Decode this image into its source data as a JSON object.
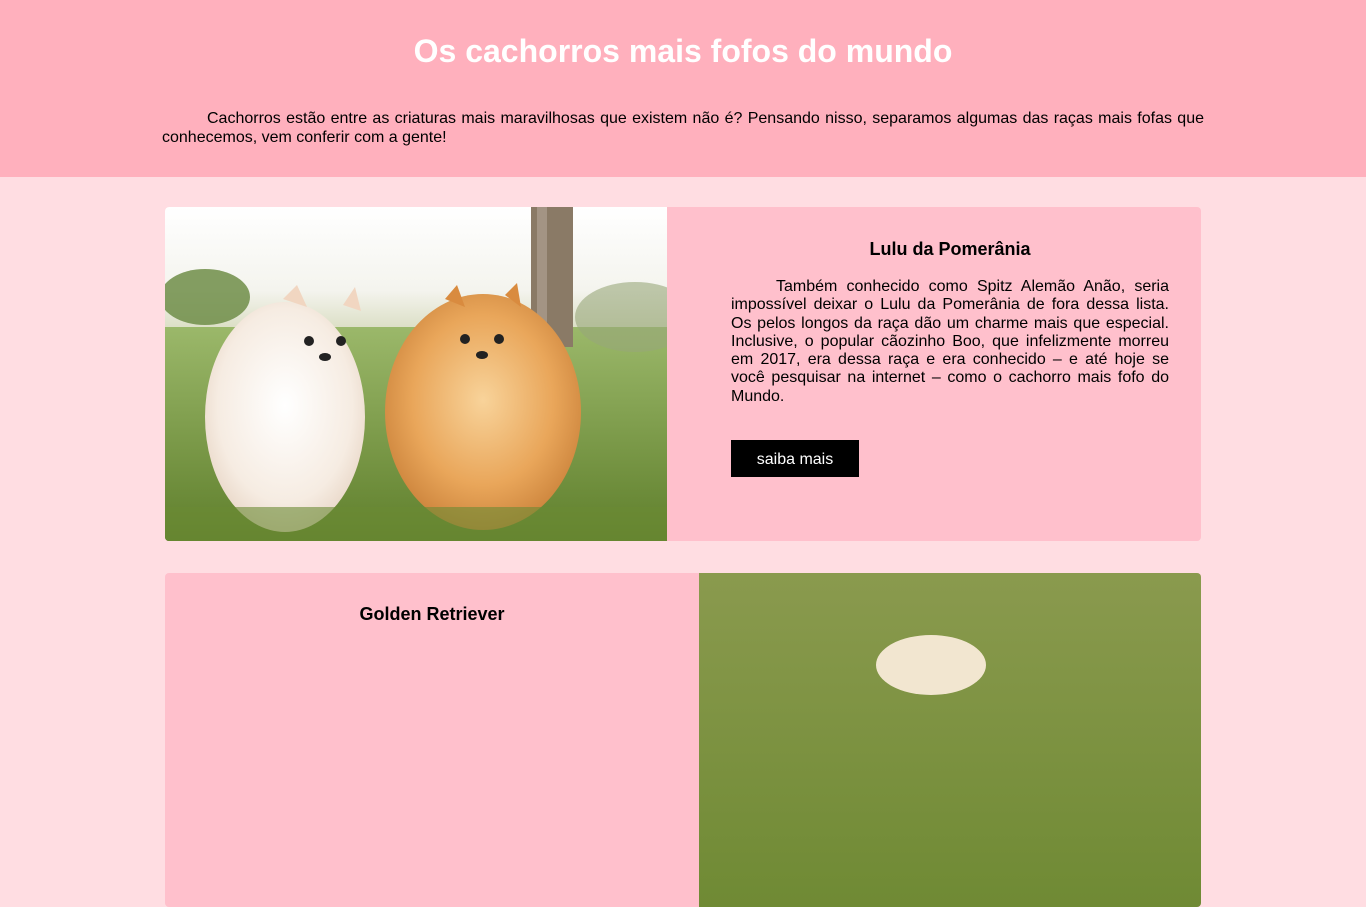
{
  "header": {
    "title": "Os cachorros mais fofos do mundo",
    "intro": "Cachorros estão entre as criaturas mais maravilhosas que existem não é? Pensando nisso, separamos algumas das raças mais fofas que conhecemos, vem conferir com a gente!"
  },
  "cards": [
    {
      "title": "Lulu da Pomerânia",
      "text": "Também conhecido como Spitz Alemão Anão, seria impossível deixar o Lulu da Pomerânia de fora dessa lista. Os pelos longos da raça dão um charme mais que especial. Inclusive, o popular cãozinho Boo, que infelizmente morreu em 2017, era dessa raça e era conhecido – e até hoje se você pesquisar na internet – como o cachorro mais fofo do Mundo.",
      "button": "saiba mais",
      "image": "two-pomeranian-dogs-photo"
    },
    {
      "title": "Golden Retriever",
      "image": "golden-retriever-photo"
    }
  ],
  "colors": {
    "header_bg": "#ffb0bd",
    "page_bg": "#ffdde2",
    "card_bg": "#ffc0cc",
    "button_bg": "#000000"
  }
}
